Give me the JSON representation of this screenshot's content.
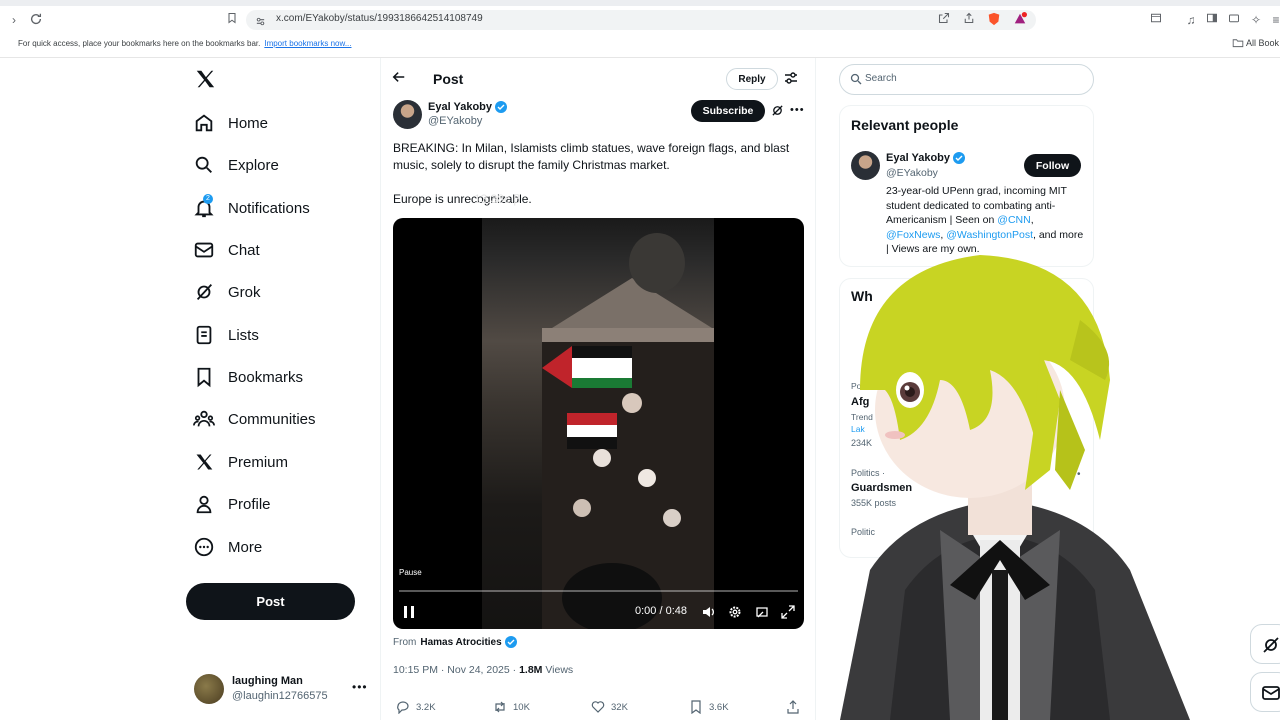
{
  "browser": {
    "url": "x.com/EYakoby/status/1993186642514108749",
    "bookmarks_hint": "For quick access, place your bookmarks here on the bookmarks bar.",
    "import_link": "Import bookmarks now...",
    "all_bookmarks": "All Book"
  },
  "nav": {
    "items": [
      {
        "label": "Home",
        "icon": "home-icon"
      },
      {
        "label": "Explore",
        "icon": "search-icon"
      },
      {
        "label": "Notifications",
        "icon": "bell-icon",
        "badge": "2"
      },
      {
        "label": "Chat",
        "icon": "mail-icon"
      },
      {
        "label": "Grok",
        "icon": "grok-icon"
      },
      {
        "label": "Lists",
        "icon": "list-icon"
      },
      {
        "label": "Bookmarks",
        "icon": "bookmark-icon"
      },
      {
        "label": "Communities",
        "icon": "people-icon"
      },
      {
        "label": "Premium",
        "icon": "x-logo-icon"
      },
      {
        "label": "Profile",
        "icon": "person-icon"
      },
      {
        "label": "More",
        "icon": "more-circle-icon"
      }
    ],
    "post_button": "Post",
    "account": {
      "name": "laughing Man",
      "handle": "@laughin12766575"
    }
  },
  "header": {
    "title": "Post",
    "reply": "Reply"
  },
  "post": {
    "author_name": "Eyal Yakoby",
    "author_handle": "@EYakoby",
    "subscribe": "Subscribe",
    "text1": "BREAKING: In Milan, Islamists climb statues, wave foreign flags, and blast music, solely to disrupt the family Christmas market.",
    "text2": "Europe is unrecognizable.",
    "ghost_overlay": "13.38c β",
    "video": {
      "tooltip": "Pause",
      "time": "0:00 / 0:48",
      "progress": 0.0
    },
    "from_prefix": "From",
    "from_account": "Hamas Atrocities",
    "timestamp": "10:15 PM · Nov 24, 2025 ·",
    "views_count": "1.8M",
    "views_label": "Views",
    "stats": {
      "replies": "3.2K",
      "reposts": "10K",
      "likes": "32K",
      "bookmarks": "3.6K"
    }
  },
  "sidebar": {
    "search_placeholder": "Search",
    "relevant_title": "Relevant people",
    "person": {
      "name": "Eyal Yakoby",
      "handle": "@EYakoby",
      "follow": "Follow",
      "bio_1": "23-year-old UPenn grad, incoming MIT student dedicated to combating anti-Americanism | Seen on ",
      "bio_cnn": "@CNN",
      "bio_2": ", ",
      "bio_fox": "@FoxNews",
      "bio_3": ", ",
      "bio_wapo": "@WashingtonPost",
      "bio_4": ", and more | Views are my own."
    },
    "trends_title": "Wh",
    "trends": [
      {
        "category": "Po",
        "name": "Afg",
        "sub": "Trend",
        "link": "Lak",
        "count": "234K"
      },
      {
        "category": "Politics ·",
        "name": "Guardsmen",
        "count": "355K posts"
      },
      {
        "category": "Politic"
      }
    ]
  },
  "colors": {
    "accent": "#1d9bf0",
    "text": "#0f1419",
    "muted": "#536471",
    "brave": "#fb542b"
  }
}
